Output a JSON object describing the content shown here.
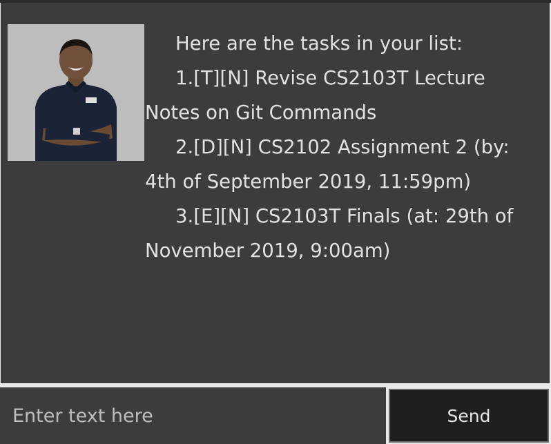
{
  "dialog": {
    "avatar_icon": "user-avatar-photo",
    "message_lines": [
      "Here are the tasks in your list:",
      "1.[T][N] Revise CS2103T Lecture",
      "Notes on Git Commands",
      "2.[D][N] CS2102 Assignment 2 (by:",
      "4th of September 2019, 11:59pm)",
      "3.[E][N] CS2103T Finals (at: 29th of",
      "November 2019, 9:00am)"
    ]
  },
  "input": {
    "placeholder": "Enter text here",
    "value": ""
  },
  "send_button": {
    "label": "Send"
  },
  "colors": {
    "dialog_bg": "#3c3c3c",
    "text": "#e2e2e2",
    "button_bg": "#1f1f1f"
  }
}
